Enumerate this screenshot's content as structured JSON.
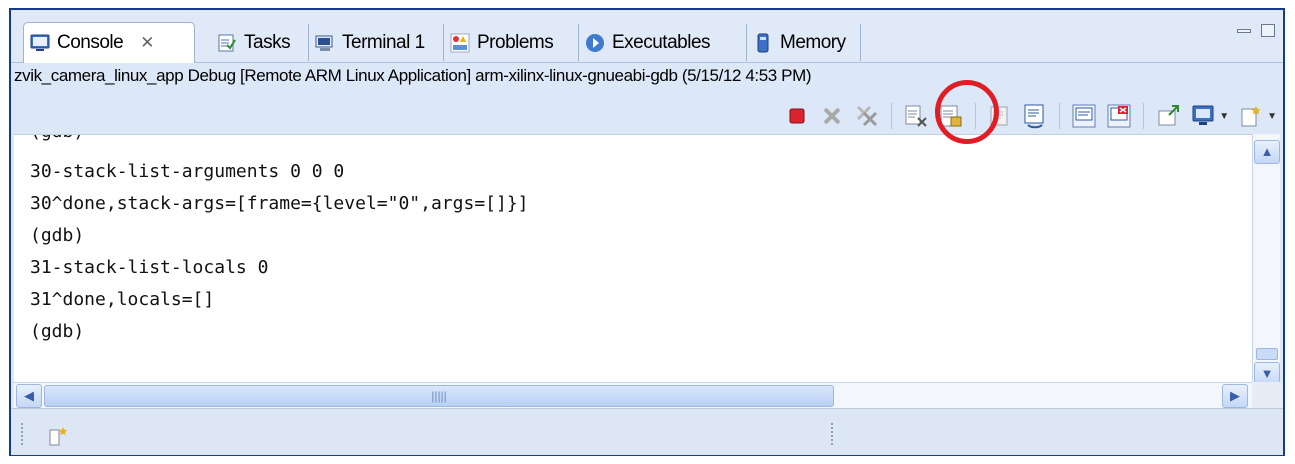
{
  "tabs": [
    {
      "label": "Console",
      "icon": "console-icon",
      "active": true,
      "close": "✕"
    },
    {
      "label": "Tasks",
      "icon": "tasks-icon"
    },
    {
      "label": "Terminal 1",
      "icon": "terminal-icon"
    },
    {
      "label": "Problems",
      "icon": "problems-icon"
    },
    {
      "label": "Executables",
      "icon": "executables-icon"
    },
    {
      "label": "Memory",
      "icon": "memory-icon"
    }
  ],
  "session": {
    "text": "zvik_camera_linux_app Debug [Remote ARM Linux Application] arm-xilinx-linux-gnueabi-gdb (5/15/12 4:53 PM)"
  },
  "toolbar": {
    "items": [
      "terminate-icon",
      "remove-launch-icon",
      "remove-all-launches-icon",
      "clear-console-icon",
      "scroll-lock-icon",
      "word-wrap-icon",
      "pin-console-icon",
      "display-selected-console-icon",
      "open-console-icon",
      "new-console-icon"
    ]
  },
  "console": {
    "lines": [
      "(gdb)",
      "30-stack-list-arguments 0 0 0",
      "30^done,stack-args=[frame={level=\"0\",args=[]}]",
      "(gdb)",
      "31-stack-list-locals 0",
      "31^done,locals=[]",
      "(gdb)"
    ]
  },
  "scrollbar": {
    "up": "▲",
    "down": "▼",
    "left": "◀",
    "right": "▶",
    "grip": "|||||"
  },
  "colors": {
    "highlight": "#e01c24",
    "frame_border": "#163a8c",
    "terminate": "#d9232e"
  }
}
